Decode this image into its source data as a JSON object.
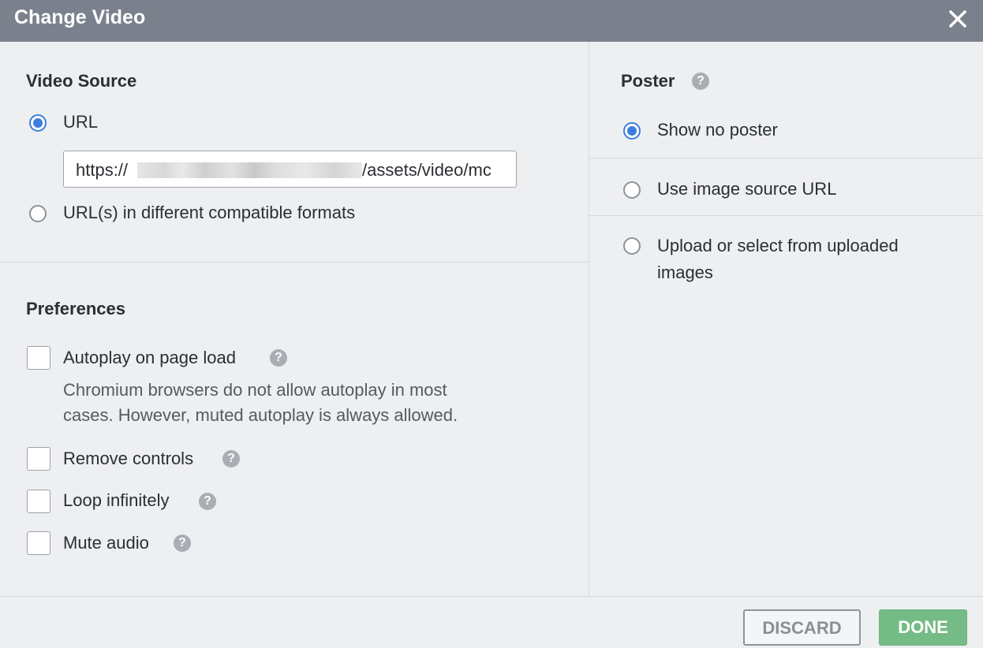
{
  "dialog": {
    "title": "Change Video"
  },
  "video_source": {
    "heading": "Video Source",
    "option_url": "URL",
    "url_prefix": "https://",
    "url_suffix": "/assets/video/mc",
    "option_formats": "URL(s) in different compatible formats",
    "selected": "URL"
  },
  "preferences": {
    "heading": "Preferences",
    "autoplay": "Autoplay on page load",
    "autoplay_note_line1": "Chromium browsers do not allow autoplay in most",
    "autoplay_note_line2": "cases. However, muted autoplay is always allowed.",
    "remove_controls": "Remove controls",
    "loop": "Loop infinitely",
    "mute": "Mute audio",
    "help_glyph": "?"
  },
  "poster": {
    "heading": "Poster",
    "option_none": "Show no poster",
    "option_url": "Use image source URL",
    "option_upload_line1": "Upload or select from uploaded",
    "option_upload_line2": "images",
    "selected": "Show no poster"
  },
  "footer": {
    "discard": "DISCARD",
    "done": "DONE"
  },
  "colors": {
    "header_bg": "#7b818c",
    "accent": "#3b7ddd",
    "done_bg": "#75bb85"
  },
  "icons": {
    "close": "close-icon",
    "help": "help-icon"
  }
}
